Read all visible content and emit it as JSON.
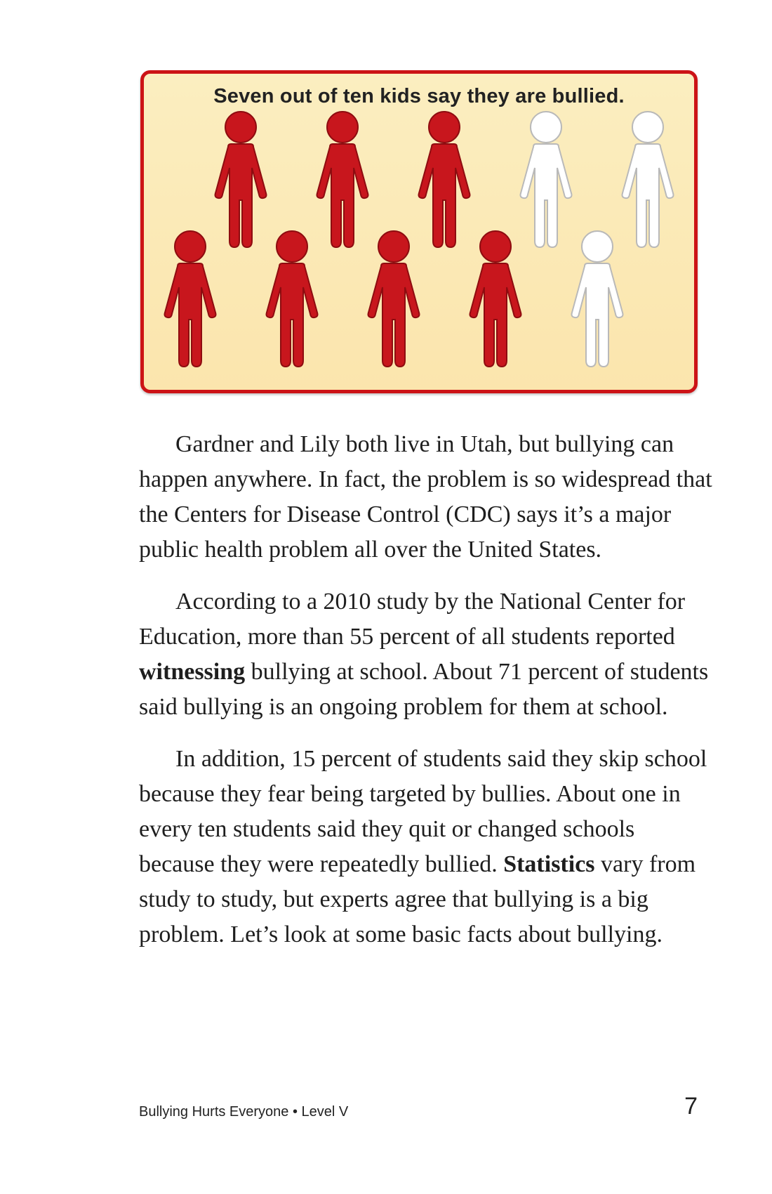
{
  "infographic": {
    "title": "Seven out of ten kids say they are bullied.",
    "total_figures": 10,
    "bullied_count": 7,
    "bullied_color": "#c8161d",
    "not_bullied_color": "#ffffff",
    "figures": [
      {
        "icon": "person-icon",
        "bullied": true
      },
      {
        "icon": "person-icon",
        "bullied": true
      },
      {
        "icon": "person-icon",
        "bullied": true
      },
      {
        "icon": "person-icon",
        "bullied": false
      },
      {
        "icon": "person-icon",
        "bullied": false
      },
      {
        "icon": "person-icon",
        "bullied": true
      },
      {
        "icon": "person-icon",
        "bullied": true
      },
      {
        "icon": "person-icon",
        "bullied": true
      },
      {
        "icon": "person-icon",
        "bullied": true
      },
      {
        "icon": "person-icon",
        "bullied": false
      }
    ]
  },
  "paragraphs": [
    {
      "segments": [
        {
          "text": "Gardner and Lily both live in Utah, but bullying can happen anywhere. In fact, the problem is so widespread that the Centers for Disease Control (CDC) says it’s a major public health problem all over the United States.",
          "bold": false
        }
      ]
    },
    {
      "segments": [
        {
          "text": "According to a 2010 study by the National Center for Education, more than 55 percent of all students reported ",
          "bold": false
        },
        {
          "text": "witnessing",
          "bold": true
        },
        {
          "text": " bullying at school. About 71 percent of students said bullying is an ongoing problem for them at school.",
          "bold": false
        }
      ]
    },
    {
      "segments": [
        {
          "text": "In addition, 15 percent of students said they skip school because they fear being targeted by bullies. About one in every ten students said they quit or changed schools because they were repeatedly bullied. ",
          "bold": false
        },
        {
          "text": "Statistics",
          "bold": true
        },
        {
          "text": " vary from study to study, but experts agree that bullying is a big problem. Let’s look at some basic facts about bullying.",
          "bold": false
        }
      ]
    }
  ],
  "footer": {
    "book_title": "Bullying Hurts Everyone • Level V",
    "page_number": "7"
  }
}
